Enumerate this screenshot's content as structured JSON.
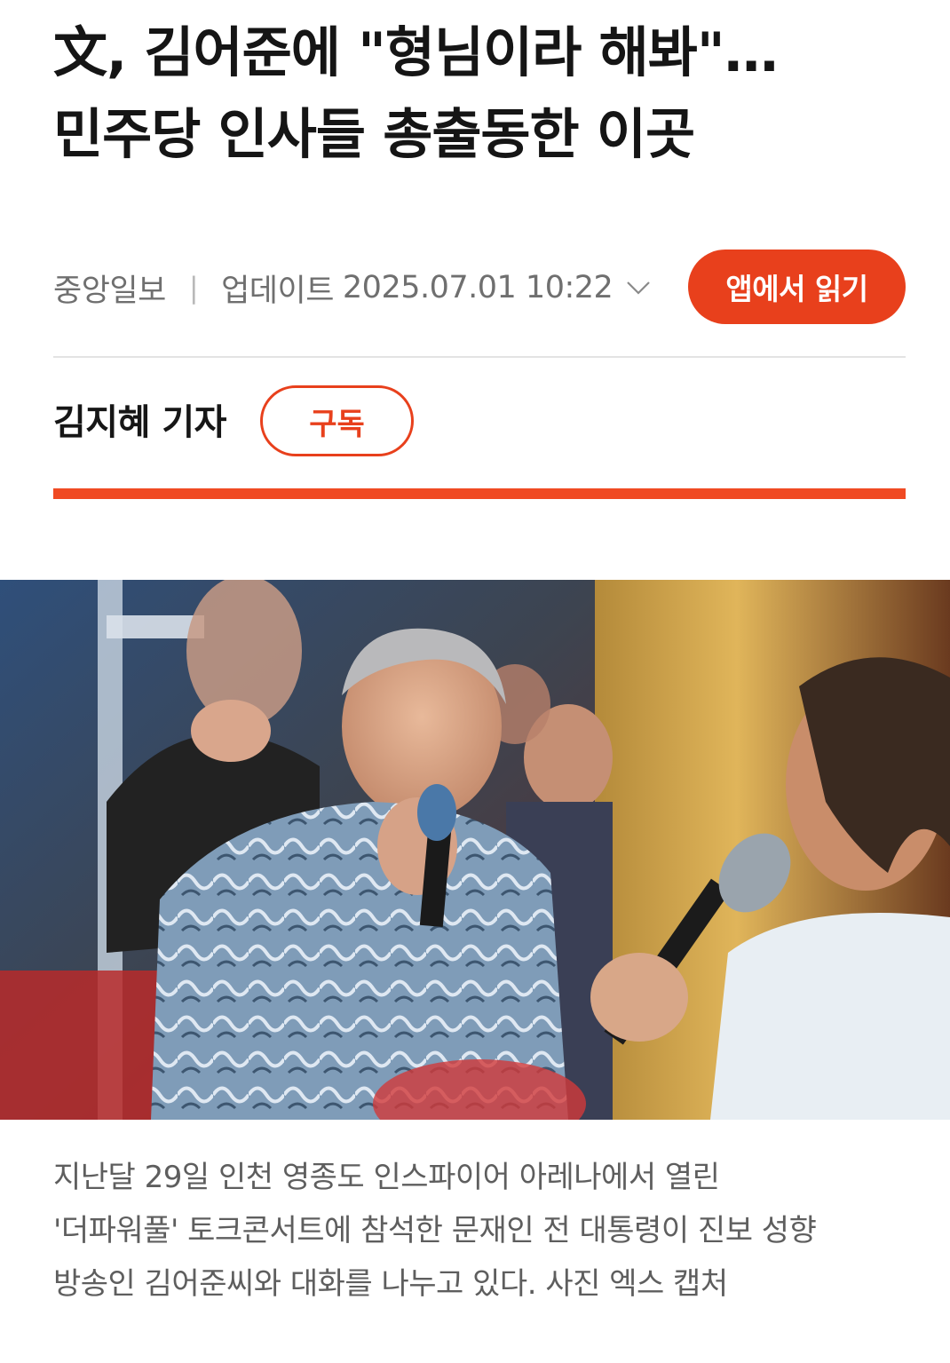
{
  "article": {
    "headline_line1": "文, 김어준에 \"형님이라 해봐\"…",
    "headline_line2": "민주당 인사들 총출동한 이곳"
  },
  "meta": {
    "publisher": "중앙일보",
    "separator": "|",
    "updated_label": "업데이트",
    "updated_time": "2025.07.01 10:22",
    "chevron_icon": "chevron-down-icon",
    "app_button_label": "앱에서 읽기"
  },
  "byline": {
    "reporter": "김지혜 기자",
    "subscribe_label": "구독"
  },
  "photo": {
    "caption_line1": "지난달 29일 인천 영종도 인스파이어 아레나에서 열린",
    "caption_line2": "'더파워풀' 토크콘서트에 참석한 문재인 전 대통령이 진보 성향",
    "caption_line3": "방송인 김어준씨와 대화를 나누고 있다. 사진 엑스 캡처"
  },
  "colors": {
    "accent": "#e8401c",
    "accent_bar": "#f04a23",
    "meta_text": "#6f6f6f",
    "caption_text": "#5e5e5e"
  }
}
